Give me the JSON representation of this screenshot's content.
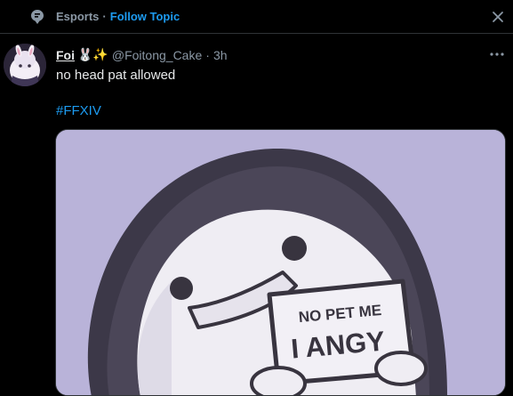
{
  "topic": {
    "name": "Esports",
    "separator": "·",
    "follow_label": "Follow Topic",
    "icon": "topic-icon"
  },
  "tweet": {
    "display_name": "Foi",
    "name_emojis": "🐰✨",
    "handle": "@Foitong_Cake",
    "separator": "·",
    "timestamp": "3h",
    "text": "no head pat allowed",
    "hashtag": "#FFXIV",
    "media": {
      "sign_line1": "NO PET ME",
      "sign_line2": "I ANGY"
    }
  },
  "colors": {
    "background": "#000000",
    "accent": "#1d9bf0",
    "secondary_text": "#8b98a5",
    "primary_text": "#e7e9ea",
    "media_background": "#b8b2d8"
  }
}
